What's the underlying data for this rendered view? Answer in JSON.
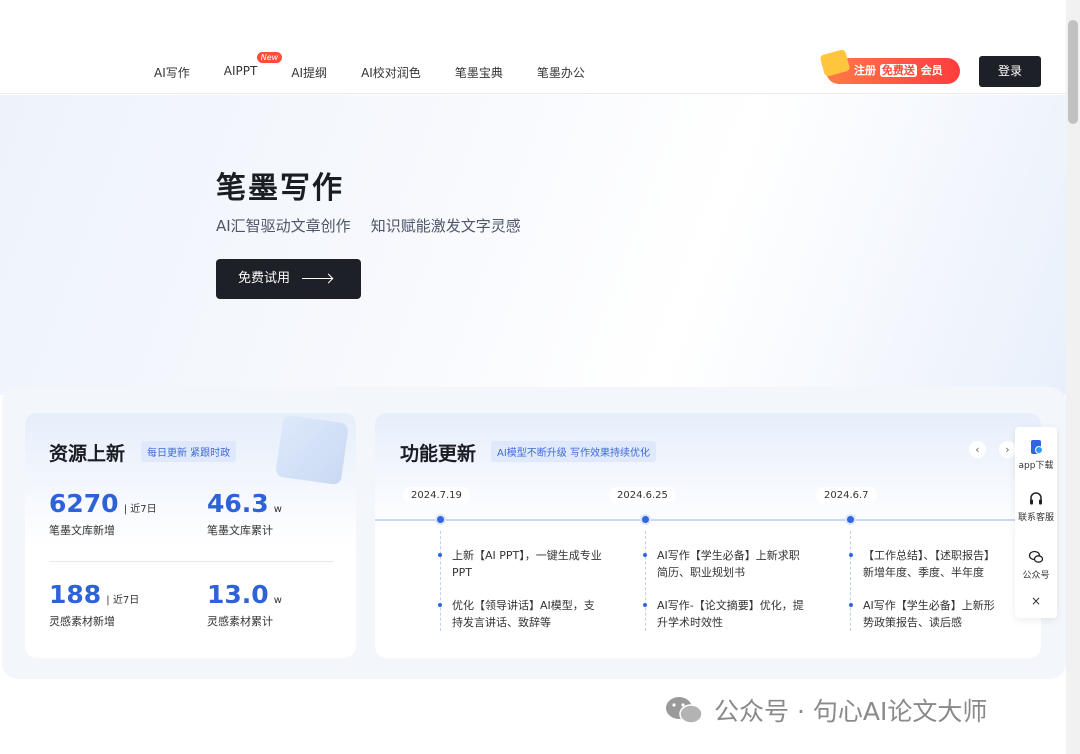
{
  "nav": {
    "items": [
      {
        "label": "AI写作"
      },
      {
        "label": "AIPPT",
        "badge": "New"
      },
      {
        "label": "AI提纲"
      },
      {
        "label": "AI校对润色"
      },
      {
        "label": "笔墨宝典"
      },
      {
        "label": "笔墨办公"
      }
    ],
    "promo_pre": "注册",
    "promo_em": "免费送",
    "promo_post": "会员",
    "login": "登录"
  },
  "hero": {
    "title": "笔墨写作",
    "subtitle_1": "AI汇智驱动文章创作",
    "subtitle_2": "知识赋能激发文字灵感",
    "cta": "免费试用"
  },
  "resources": {
    "title": "资源上新",
    "tag": "每日更新 紧跟时政",
    "stats": [
      {
        "value": "6270",
        "unit": "| 近7日",
        "label": "笔墨文库新增"
      },
      {
        "value": "46.3",
        "unit": "w",
        "label": "笔墨文库累计"
      },
      {
        "value": "188",
        "unit": "| 近7日",
        "label": "灵感素材新增"
      },
      {
        "value": "13.0",
        "unit": "w",
        "label": "灵感素材累计"
      }
    ]
  },
  "updates": {
    "title": "功能更新",
    "tag": "AI模型不断升级 写作效果持续优化",
    "prev": "‹",
    "next": "›",
    "columns": [
      {
        "date": "2024.7.19",
        "items": [
          "上新【AI PPT】，一键生成专业PPT",
          "优化【领导讲话】AI模型，支持发言讲话、致辞等"
        ]
      },
      {
        "date": "2024.6.25",
        "items": [
          "AI写作【学生必备】上新求职简历、职业规划书",
          "AI写作-【论文摘要】优化，提升学术时效性"
        ]
      },
      {
        "date": "2024.6.7",
        "items": [
          "【工作总结】、【述职报告】新增年度、季度、半年度",
          "AI写作【学生必备】上新形势政策报告、读后感"
        ]
      }
    ]
  },
  "side": {
    "app": "app下载",
    "service": "联系客服",
    "wechat": "公众号",
    "close": "×"
  },
  "watermark": "公众号 · 句心AI论文大师",
  "colors": {
    "accent": "#2d62d8",
    "dark": "#1d2026",
    "promo": "#ff4d3a"
  }
}
